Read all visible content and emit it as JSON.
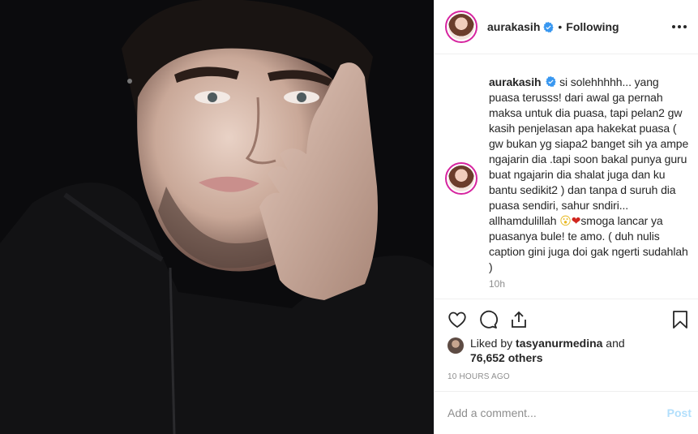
{
  "header": {
    "username": "aurakasih",
    "separator": "•",
    "follow_status": "Following"
  },
  "caption": {
    "username": "aurakasih",
    "text_before_emoji": " si solehhhhh... yang puasa terusss! dari awal ga pernah maksa untuk dia puasa, tapi pelan2 gw kasih penjelasan apa hakekat puasa ( gw bukan yg siapa2 banget sih ya ampe ngajarin dia .tapi soon bakal punya guru buat ngajarin dia shalat juga dan ku bantu sedikit2 ) dan tanpa d suruh dia puasa sendiri, sahur sndiri... allhamdulillah ",
    "emoji_1": "😮",
    "emoji_2": "❤",
    "text_after_emoji": "smoga lancar ya puasanya bule! te amo. ( duh nulis caption gini juga doi gak ngerti sudahlah )",
    "time": "10h"
  },
  "likes": {
    "prefix": "Liked by ",
    "liker": "tasyanurmedina",
    "conjunction": " and",
    "others_count": "76,652 others"
  },
  "post_time": "10 HOURS AGO",
  "comment": {
    "placeholder": "Add a comment...",
    "post_label": "Post"
  },
  "colors": {
    "verified": "#3897f0",
    "post_button": "#b2dffc",
    "secondary_text": "#8e8e8e"
  },
  "icons": [
    "heart-icon",
    "comment-icon",
    "share-icon",
    "bookmark-icon",
    "more-icon",
    "verified-badge-icon"
  ]
}
